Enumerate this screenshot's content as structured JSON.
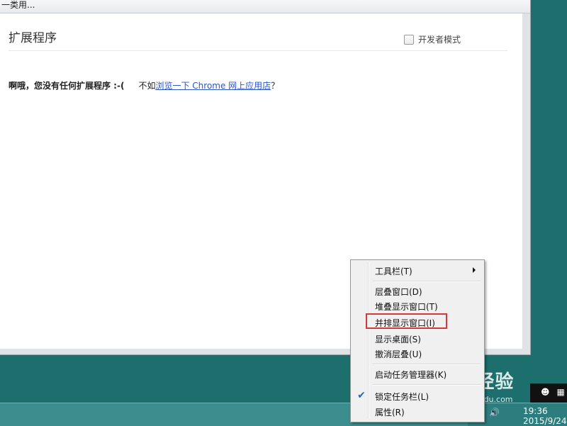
{
  "window": {
    "title_fragment": "一类用...",
    "page_title": "扩展程序",
    "developer_mode_label": "开发者模式",
    "empty_message_bold": "啊哦，您没有任何扩展程序 :-(",
    "empty_message_prefix": "不如",
    "store_link": "浏览一下 Chrome 网上应用店",
    "empty_message_suffix": "？"
  },
  "context_menu": {
    "items": [
      {
        "label": "工具栏(T)",
        "submenu": true
      },
      {
        "label": "层叠窗口(D)"
      },
      {
        "label": "堆叠显示窗口(T)"
      },
      {
        "label": "并排显示窗口(I)",
        "highlighted": true
      },
      {
        "label": "显示桌面(S)"
      },
      {
        "label": "撤消层叠(U)"
      },
      {
        "label": "启动任务管理器(K)"
      },
      {
        "label": "锁定任务栏(L)",
        "checked": true
      },
      {
        "label": "属性(R)"
      }
    ]
  },
  "taskbar": {
    "time": "19:36",
    "date": "2015/9/24"
  },
  "watermark": {
    "main": "Bai 经验",
    "sub": "jingyan.baidu.com"
  },
  "colors": {
    "desktop": "#1c6f6c",
    "highlight_border": "#d13a3a",
    "link": "#2a55c9"
  }
}
